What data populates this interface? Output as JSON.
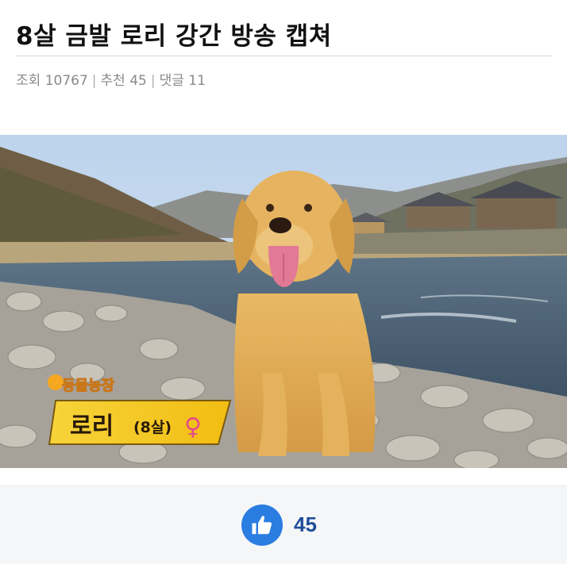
{
  "post": {
    "title": "8살 금발 로리 강간 방송 캡쳐",
    "meta": {
      "views_label": "조회",
      "views": "10767",
      "recommend_label": "추천",
      "recommend": "45",
      "comments_label": "댓글",
      "comments": "11"
    }
  },
  "image": {
    "caption_logo": "동물농장",
    "caption_name": "로리",
    "caption_age": "(8살)",
    "caption_gender": "♀"
  },
  "footer": {
    "like_icon": "thumbs-up-icon",
    "like_count": "45"
  },
  "colors": {
    "accent": "#2a7de1",
    "count": "#1f4e9a",
    "caption_band": "#f5c81a",
    "gender": "#e34b8a"
  }
}
